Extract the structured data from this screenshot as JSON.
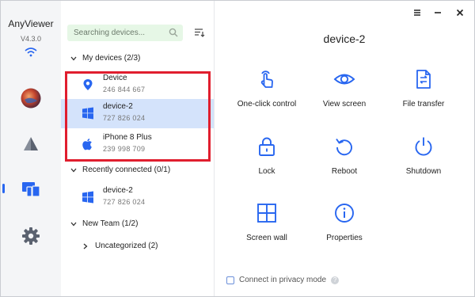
{
  "app": {
    "name": "AnyViewer",
    "version": "V4.3.0"
  },
  "search": {
    "placeholder": "Searching devices..."
  },
  "groups": {
    "my_devices": "My devices (2/3)",
    "recent": "Recently connected (0/1)",
    "team": "New Team (1/2)",
    "uncategorized": "Uncategorized (2)"
  },
  "my_devices": [
    {
      "name": "Device",
      "id": "246 844 667",
      "icon": "location-pin-icon"
    },
    {
      "name": "device-2",
      "id": "727 826 024",
      "icon": "windows-icon"
    },
    {
      "name": "iPhone 8 Plus",
      "id": "239 998 709",
      "icon": "apple-icon"
    }
  ],
  "recent_devices": [
    {
      "name": "device-2",
      "id": "727 826 024",
      "icon": "windows-icon"
    }
  ],
  "main": {
    "title": "device-2",
    "actions": [
      {
        "label": "One-click control",
        "icon": "touch-hand-icon"
      },
      {
        "label": "View screen",
        "icon": "eye-icon"
      },
      {
        "label": "File transfer",
        "icon": "file-transfer-icon"
      },
      {
        "label": "Lock",
        "icon": "lock-icon"
      },
      {
        "label": "Reboot",
        "icon": "reboot-icon"
      },
      {
        "label": "Shutdown",
        "icon": "power-icon"
      },
      {
        "label": "Screen wall",
        "icon": "screen-wall-icon"
      },
      {
        "label": "Properties",
        "icon": "info-icon"
      }
    ],
    "privacy_label": "Connect in privacy mode",
    "help_glyph": "?"
  },
  "colors": {
    "accent": "#2866f0",
    "selected_bg": "#d4e3fb",
    "highlight": "#e01e2e",
    "search_bg": "#e6f7e6"
  }
}
